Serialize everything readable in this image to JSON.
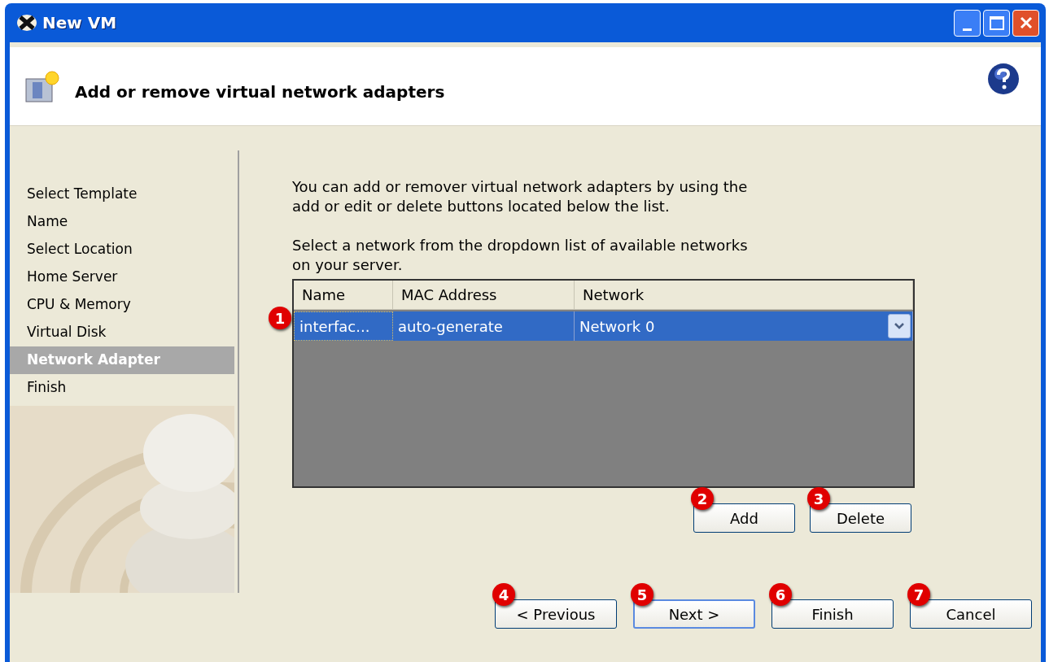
{
  "window": {
    "title": "New VM"
  },
  "header": {
    "title": "Add or remove virtual network adapters"
  },
  "sidebar": {
    "items": [
      {
        "label": "Select Template",
        "selected": false
      },
      {
        "label": "Name",
        "selected": false
      },
      {
        "label": "Select Location",
        "selected": false
      },
      {
        "label": "Home Server",
        "selected": false
      },
      {
        "label": "CPU & Memory",
        "selected": false
      },
      {
        "label": "Virtual Disk",
        "selected": false
      },
      {
        "label": "Network Adapter",
        "selected": true
      },
      {
        "label": "Finish",
        "selected": false
      }
    ]
  },
  "description": [
    "You can add or remover virtual network adapters by using the add or edit or delete buttons located below the list.",
    "Select a network from the dropdown list of available networks on your server."
  ],
  "table": {
    "columns": [
      "Name",
      "MAC Address",
      "Network"
    ],
    "rows": [
      {
        "cells": [
          "interfac...",
          "auto-generate",
          "Network 0"
        ],
        "selected": true,
        "callout": "1"
      }
    ]
  },
  "list_buttons": [
    {
      "label": "Add",
      "callout": "2"
    },
    {
      "label": "Delete",
      "callout": "3"
    }
  ],
  "buttons": [
    {
      "label": "< Previous",
      "callout": "4",
      "default": false
    },
    {
      "label": "Next >",
      "callout": "5",
      "default": true
    },
    {
      "label": "Finish",
      "callout": "6",
      "default": false
    },
    {
      "label": "Cancel",
      "callout": "7",
      "default": false
    }
  ]
}
